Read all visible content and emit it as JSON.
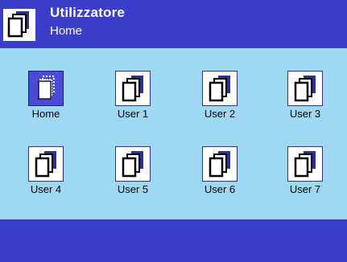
{
  "header": {
    "title": "Utilizzatore",
    "subtitle": "Home",
    "icon": "user-profiles-icon"
  },
  "tiles": [
    {
      "label": "Home",
      "icon": "user-profile-icon",
      "selected": true
    },
    {
      "label": "User 1",
      "icon": "user-profile-icon",
      "selected": false
    },
    {
      "label": "User 2",
      "icon": "user-profile-icon",
      "selected": false
    },
    {
      "label": "User 3",
      "icon": "user-profile-icon",
      "selected": false
    },
    {
      "label": "User 4",
      "icon": "user-profile-icon",
      "selected": false
    },
    {
      "label": "User 5",
      "icon": "user-profile-icon",
      "selected": false
    },
    {
      "label": "User 6",
      "icon": "user-profile-icon",
      "selected": false
    },
    {
      "label": "User 7",
      "icon": "user-profile-icon",
      "selected": false
    }
  ],
  "colors": {
    "header_bg": "#3c3dc8",
    "content_bg": "#9fd8f3",
    "selected_bg": "#4a4bd6"
  }
}
